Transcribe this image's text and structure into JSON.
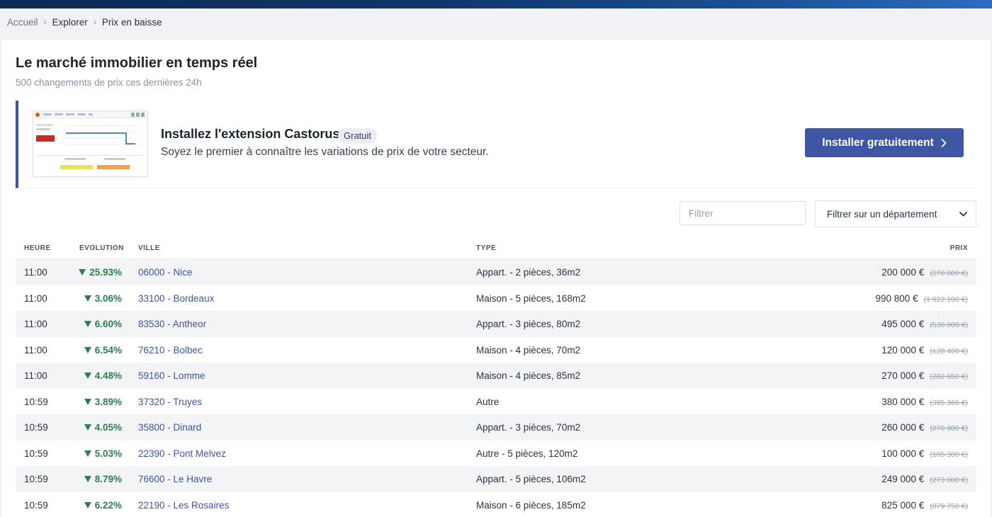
{
  "breadcrumb": {
    "home": "Accueil",
    "explore": "Explorer",
    "current": "Prix en baisse",
    "separator": "›"
  },
  "header": {
    "title": "Le marché immobilier en temps réel",
    "subtitle": "500 changements de prix ces dernières 24h"
  },
  "promo": {
    "title": "Installez l'extension Castorus",
    "badge": "Gratuit",
    "description": "Soyez le premier à connaître les variations de prix de votre secteur.",
    "button_label": "Installer gratuitement"
  },
  "filters": {
    "text_placeholder": "Filtrer",
    "department_selected": "Filtrer sur un département"
  },
  "table": {
    "columns": {
      "time": "HEURE",
      "evolution": "EVOLUTION",
      "city": "VILLE",
      "type": "TYPE",
      "price": "PRIX"
    },
    "rows": [
      {
        "time": "11:00",
        "evolution": "25.93%",
        "city": "06000 - Nice",
        "type": "Appart. - 2 pièces, 36m2",
        "price": "200 000 €",
        "old_price": "(270 000 €)"
      },
      {
        "time": "11:00",
        "evolution": "3.06%",
        "city": "33100 - Bordeaux",
        "type": "Maison - 5 pièces, 168m2",
        "price": "990 800 €",
        "old_price": "(1 022 100 €)"
      },
      {
        "time": "11:00",
        "evolution": "6.60%",
        "city": "83530 - Antheor",
        "type": "Appart. - 3 pièces, 80m2",
        "price": "495 000 €",
        "old_price": "(530 000 €)"
      },
      {
        "time": "11:00",
        "evolution": "6.54%",
        "city": "76210 - Bolbec",
        "type": "Maison - 4 pièces, 70m2",
        "price": "120 000 €",
        "old_price": "(128 400 €)"
      },
      {
        "time": "11:00",
        "evolution": "4.48%",
        "city": "59160 - Lomme",
        "type": "Maison - 4 pièces, 85m2",
        "price": "270 000 €",
        "old_price": "(282 650 €)"
      },
      {
        "time": "10:59",
        "evolution": "3.89%",
        "city": "37320 - Truyes",
        "type": "Autre",
        "price": "380 000 €",
        "old_price": "(395 360 €)"
      },
      {
        "time": "10:59",
        "evolution": "4.05%",
        "city": "35800 - Dinard",
        "type": "Appart. - 3 pièces, 70m2",
        "price": "260 000 €",
        "old_price": "(270 980 €)"
      },
      {
        "time": "10:59",
        "evolution": "5.03%",
        "city": "22390 - Pont Melvez",
        "type": "Autre - 5 pièces, 120m2",
        "price": "100 000 €",
        "old_price": "(105 300 €)"
      },
      {
        "time": "10:59",
        "evolution": "8.79%",
        "city": "76600 - Le Havre",
        "type": "Appart. - 5 pièces, 106m2",
        "price": "249 000 €",
        "old_price": "(273 000 €)"
      },
      {
        "time": "10:59",
        "evolution": "6.22%",
        "city": "22190 - Les Rosaires",
        "type": "Maison - 6 pièces, 185m2",
        "price": "825 000 €",
        "old_price": "(879 750 €)"
      }
    ]
  },
  "colors": {
    "accent": "#3e55a4",
    "decrease": "#2e7d4f",
    "topbar": "#10376b"
  },
  "icons": {
    "evolution": "triangle-down-icon",
    "button": "chevron-right-icon",
    "select": "chevron-down-icon"
  }
}
